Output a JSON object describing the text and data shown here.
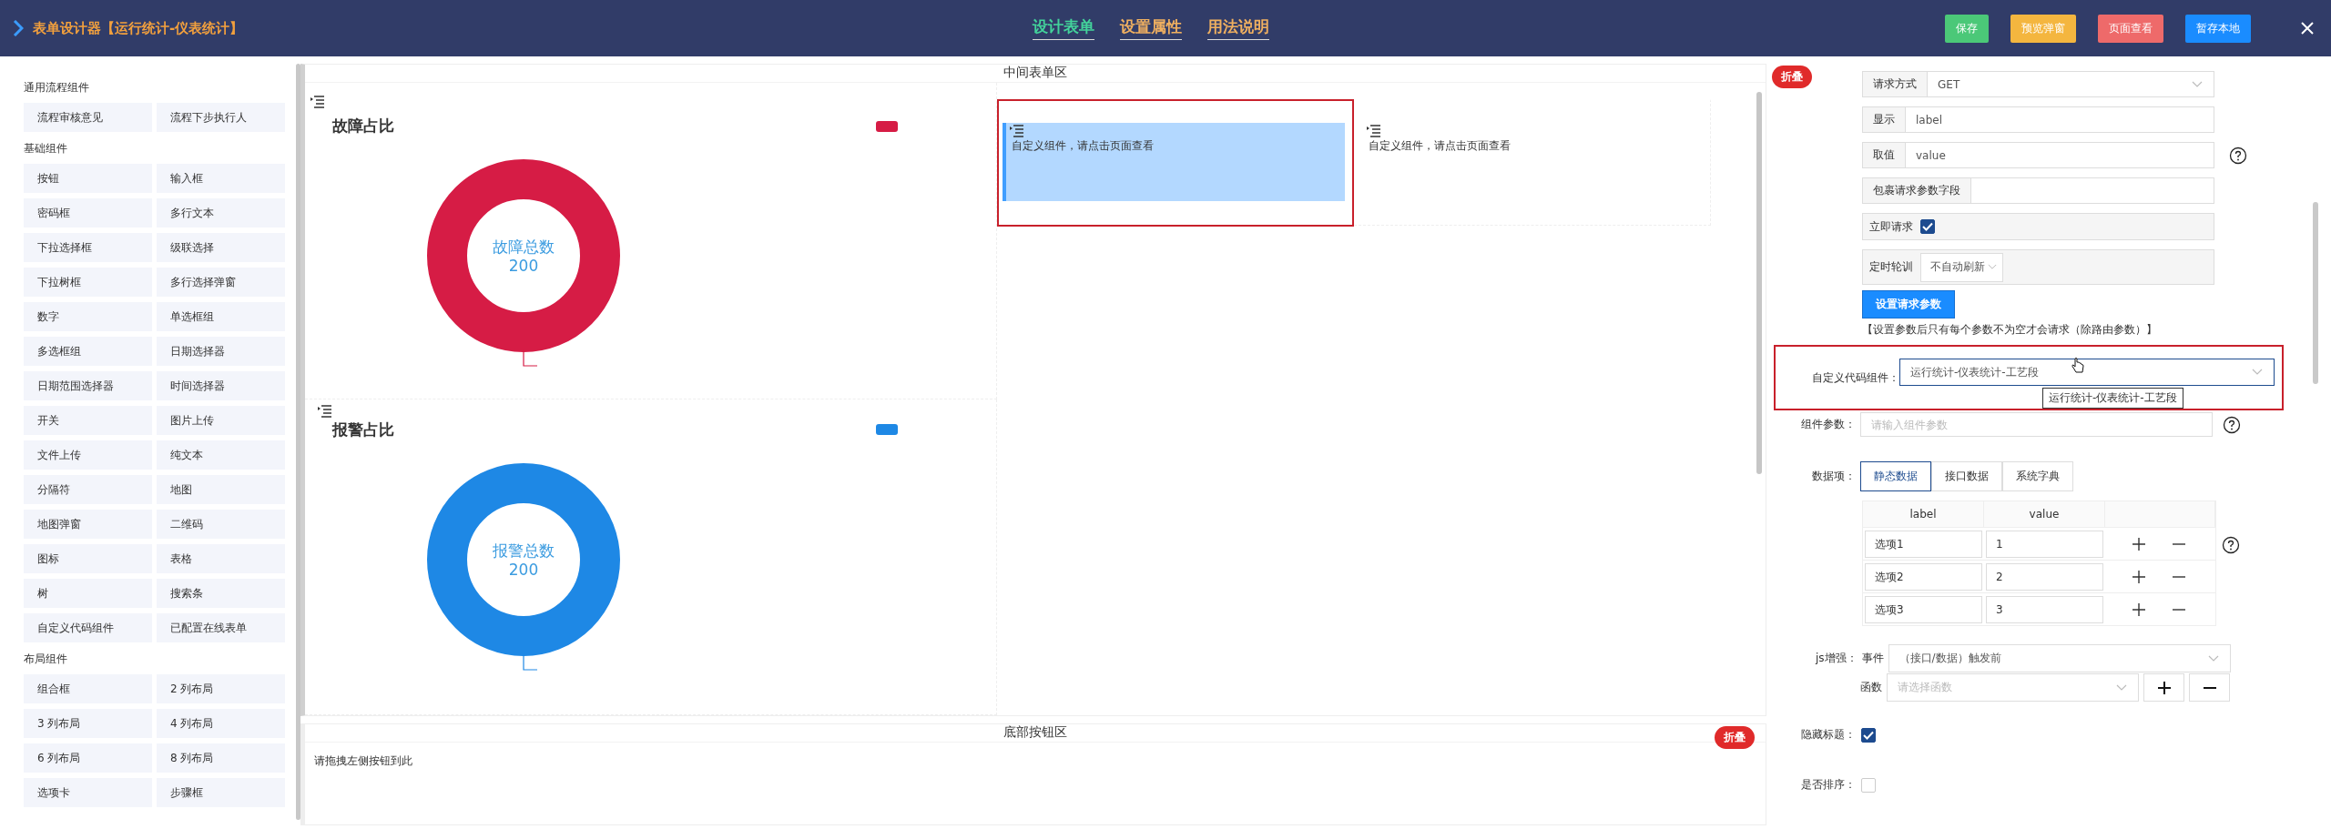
{
  "header": {
    "title": "表单设计器【运行统计-仪表统计】",
    "tabs": [
      {
        "label": "设计表单",
        "selected": true
      },
      {
        "label": "设置属性",
        "selected": false
      },
      {
        "label": "用法说明",
        "selected": false
      }
    ],
    "buttons": [
      {
        "label": "保存",
        "color": "#4bc878"
      },
      {
        "label": "预览弹窗",
        "color": "#f4b63f"
      },
      {
        "label": "页面查看",
        "color": "#ee6a6a"
      },
      {
        "label": "暂存本地",
        "color": "#1a8cff"
      }
    ]
  },
  "sidebar": {
    "groups": [
      {
        "title": "通用流程组件",
        "items": [
          "流程审核意见",
          "流程下步执行人"
        ]
      },
      {
        "title": "基础组件",
        "items": [
          "按钮",
          "输入框",
          "密码框",
          "多行文本",
          "下拉选择框",
          "级联选择",
          "下拉树框",
          "多行选择弹窗",
          "数字",
          "单选框组",
          "多选框组",
          "日期选择器",
          "日期范围选择器",
          "时间选择器",
          "开关",
          "图片上传",
          "文件上传",
          "纯文本",
          "分隔符",
          "地图",
          "地图弹窗",
          "二维码",
          "图标",
          "表格",
          "树",
          "搜索条",
          "自定义代码组件",
          "已配置在线表单"
        ]
      },
      {
        "title": "布局组件",
        "items": [
          "组合框",
          "2 列布局",
          "3 列布局",
          "4 列布局",
          "6 列布局",
          "8 列布局",
          "选项卡",
          "步骤框"
        ]
      }
    ]
  },
  "center": {
    "title": "中间表单区",
    "charts": [
      {
        "title": "故障占比",
        "center_label": "故障总数",
        "center_value": "200",
        "color": "#d61c45"
      },
      {
        "title": "报警占比",
        "center_label": "报警总数",
        "center_value": "200",
        "color": "#1e88e5"
      }
    ],
    "custom_cells": [
      {
        "text": "自定义组件，请点击页面查看",
        "selected": true,
        "annotated": true
      },
      {
        "text": "自定义组件，请点击页面查看",
        "selected": false,
        "annotated": false
      }
    ]
  },
  "bottom": {
    "title": "底部按钮区",
    "hint": "请拖拽左侧按钮到此",
    "collapse_label": "折叠"
  },
  "properties": {
    "collapse_label": "折叠",
    "request_method": {
      "label": "请求方式",
      "value": "GET"
    },
    "display": {
      "label": "显示",
      "value": "label"
    },
    "value_field": {
      "label": "取值",
      "value": "value"
    },
    "wrap_field": {
      "label": "包裹请求参数字段"
    },
    "immediate": {
      "label": "立即请求",
      "checked": true
    },
    "polling": {
      "label": "定时轮训",
      "value": "不自动刷新"
    },
    "set_params_button": "设置请求参数",
    "note": "【设置参数后只有每个参数不为空才会请求（除路由参数）】",
    "custom_component": {
      "label": "自定义代码组件：",
      "value": "运行统计-仪表统计-工艺段",
      "tooltip": "运行统计-仪表统计-工艺段",
      "annotated": true
    },
    "component_params": {
      "label": "组件参数：",
      "placeholder": "请输入组件参数"
    },
    "data_items": {
      "label": "数据项：",
      "tabs": [
        {
          "label": "静态数据",
          "selected": true
        },
        {
          "label": "接口数据",
          "selected": false
        },
        {
          "label": "系统字典",
          "selected": false
        }
      ],
      "columns": [
        "label",
        "value"
      ],
      "rows": [
        {
          "label": "选项1",
          "value": "1"
        },
        {
          "label": "选项2",
          "value": "2"
        },
        {
          "label": "选项3",
          "value": "3"
        }
      ]
    },
    "js": {
      "label": "js增强：",
      "event_label": "事件",
      "event_value": "（接口/数据）触发前",
      "function_label": "函数",
      "function_placeholder": "请选择函数"
    },
    "hide_title": {
      "label": "隐藏标题：",
      "checked": true
    },
    "sort": {
      "label": "是否排序：",
      "checked": false
    }
  }
}
